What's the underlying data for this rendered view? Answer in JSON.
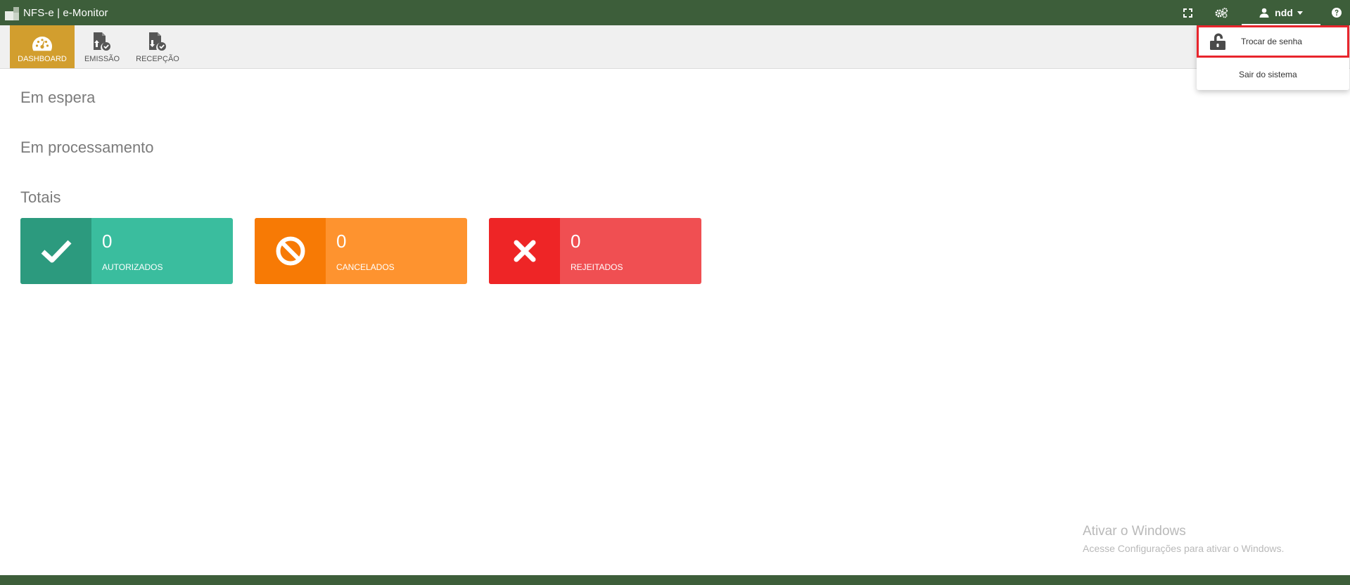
{
  "app": {
    "title": "NFS-e | e-Monitor"
  },
  "topbar": {
    "user_name": "ndd",
    "icons": [
      "fullscreen-icon",
      "gears-icon",
      "user-icon",
      "caret-down-icon",
      "help-icon"
    ]
  },
  "nav": {
    "items": [
      {
        "label": "DASHBOARD",
        "icon": "dashboard-gauge-icon",
        "active": true
      },
      {
        "label": "EMISSÃO",
        "icon": "document-upload-check-icon",
        "active": false
      },
      {
        "label": "RECEPÇÃO",
        "icon": "document-download-check-icon",
        "active": false
      }
    ]
  },
  "main": {
    "sections": [
      "Em espera",
      "Em processamento",
      "Totais"
    ],
    "cards": [
      {
        "value": "0",
        "label": "AUTORIZADOS",
        "icon": "check-icon",
        "color": "#3abd9e",
        "icon_bg": "#2c9a7e"
      },
      {
        "value": "0",
        "label": "CANCELADOS",
        "icon": "ban-icon",
        "color": "#fe932f",
        "icon_bg": "#f77a05"
      },
      {
        "value": "0",
        "label": "REJEITADOS",
        "icon": "times-icon",
        "color": "#f04f52",
        "icon_bg": "#ee2526"
      }
    ]
  },
  "user_dropdown": {
    "items": [
      {
        "label": "Trocar de senha",
        "icon": "unlock-icon",
        "highlighted": true
      },
      {
        "label": "Sair do sistema"
      }
    ]
  },
  "watermark": {
    "title": "Ativar o Windows",
    "subtitle": "Acesse Configurações para ativar o Windows."
  },
  "colors": {
    "topbar": "#3d5e3a",
    "nav_active": "#d29e2e",
    "nav_bg": "#f0f0f0",
    "highlight_border": "#e8252c"
  }
}
